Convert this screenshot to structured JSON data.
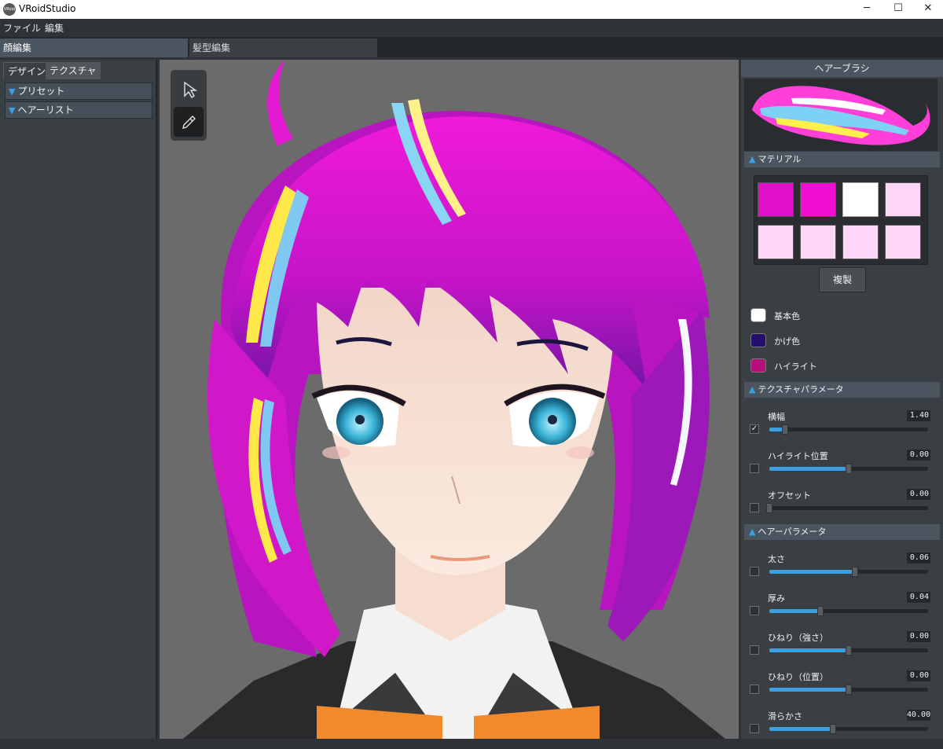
{
  "window": {
    "title": "VRoidStudio",
    "icon_text": "VRoid",
    "controls": [
      "─",
      "☐",
      "✕"
    ]
  },
  "menu": {
    "items": [
      "ファイル",
      "編集"
    ]
  },
  "mode_tabs": [
    {
      "label": "顔編集",
      "active": true
    },
    {
      "label": "髪型編集",
      "active": false
    }
  ],
  "left": {
    "tabs": [
      {
        "label": "デザイン",
        "active": true
      },
      {
        "label": "テクスチャ",
        "active": false
      }
    ],
    "sections": [
      "プリセット",
      "ヘアーリスト"
    ]
  },
  "tools": {
    "select": "select-tool",
    "brush": "brush-tool"
  },
  "right": {
    "header": "ヘアーブラシ",
    "material": {
      "title": "マテリアル",
      "swatches": [
        "#e010c8",
        "#f20fd2",
        "#ffffff",
        "#ffd6f8",
        "#ffd6f8",
        "#ffd6f8",
        "#ffd6f8",
        "#ffd6f8"
      ],
      "copy_label": "複製"
    },
    "colors": [
      {
        "label": "基本色",
        "color": "#ffffff"
      },
      {
        "label": "かげ色",
        "color": "#23106a"
      },
      {
        "label": "ハイライト",
        "color": "#b3107e"
      }
    ],
    "texture_params": {
      "title": "テクスチャパラメータ",
      "items": [
        {
          "label": "横幅",
          "value": "1.40",
          "checked": true,
          "level": 0.1
        },
        {
          "label": "ハイライト位置",
          "value": "0.00",
          "checked": false,
          "level": 0.5
        },
        {
          "label": "オフセット",
          "value": "0.00",
          "checked": false,
          "level": 0.0
        }
      ]
    },
    "hair_params": {
      "title": "ヘアーパラメータ",
      "items": [
        {
          "label": "太さ",
          "value": "0.06",
          "checked": false,
          "level": 0.54
        },
        {
          "label": "厚み",
          "value": "0.04",
          "checked": false,
          "level": 0.32
        },
        {
          "label": "ひねり（強さ）",
          "value": "0.00",
          "checked": false,
          "level": 0.5
        },
        {
          "label": "ひねり（位置）",
          "value": "0.00",
          "checked": false,
          "level": 0.5
        },
        {
          "label": "滑らかさ",
          "value": "40.00",
          "checked": false,
          "level": 0.4
        }
      ]
    }
  }
}
